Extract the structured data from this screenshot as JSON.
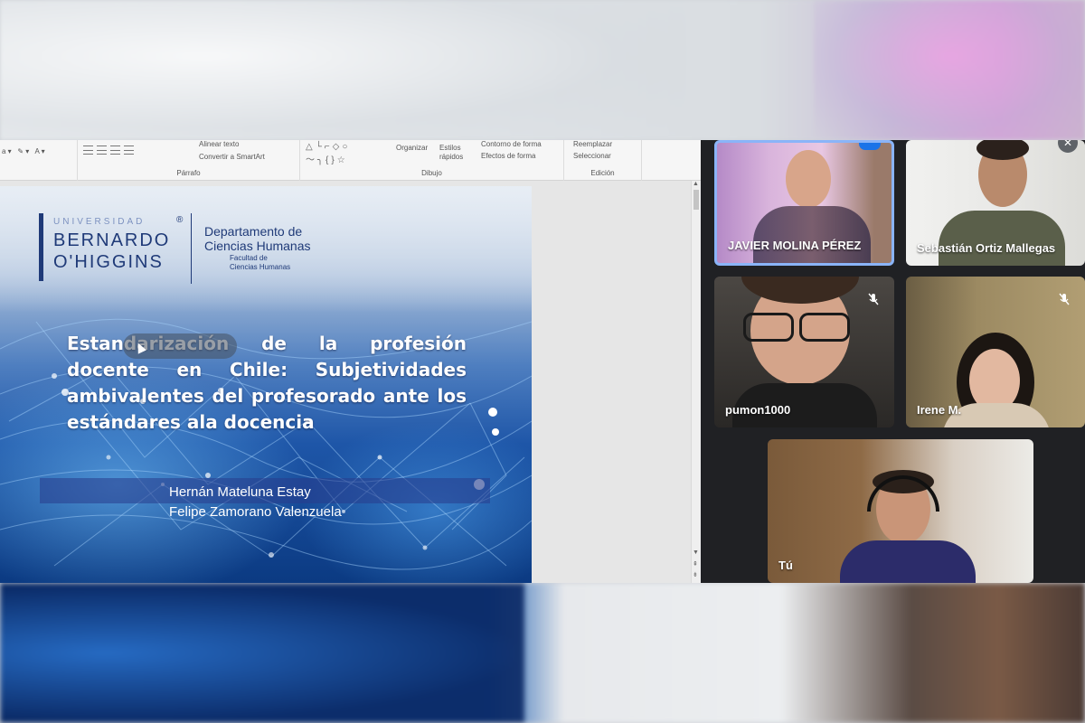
{
  "ribbon": {
    "groups": [
      "Párrafo",
      "Dibujo",
      "Edición"
    ],
    "align_text": "Alinear texto",
    "convert_smartart": "Convertir a SmartArt",
    "organize": "Organizar",
    "quick_styles": "Estilos rápidos",
    "shape_outline": "Contorno de forma",
    "shape_effects": "Efectos de forma",
    "replace": "Reemplazar",
    "select": "Seleccionar"
  },
  "slide": {
    "logo": {
      "top": "UNIVERSIDAD",
      "name_line1": "BERNARDO",
      "name_line2": "O'HIGGINS",
      "registered": "®",
      "dept_line1": "Departamento de",
      "dept_line2": "Ciencias Humanas",
      "fac_line1": "Facultad de",
      "fac_line2": "Ciencias Humanas"
    },
    "title": "Estandarización de la profesión docente en Chile: Subjetividades ambivalentes del profesorado ante los estándares ala docencia",
    "authors": [
      "Hernán Mateluna Estay",
      "Felipe Zamorano Valenzuela"
    ]
  },
  "meet": {
    "participants": [
      {
        "name": "JAVIER MOLINA PÉREZ",
        "speaking": true
      },
      {
        "name": "Sebastián Ortiz Mallegas",
        "muted": false
      },
      {
        "name": "pumon1000",
        "muted": true
      },
      {
        "name": "Irene M.",
        "muted": true
      },
      {
        "name": "Tú",
        "muted": false
      }
    ]
  },
  "colors": {
    "meet_bg": "#202124",
    "speaking_border": "#8ab4f8",
    "slide_blue": "#1e56a8",
    "logo_navy": "#1f3a78"
  }
}
